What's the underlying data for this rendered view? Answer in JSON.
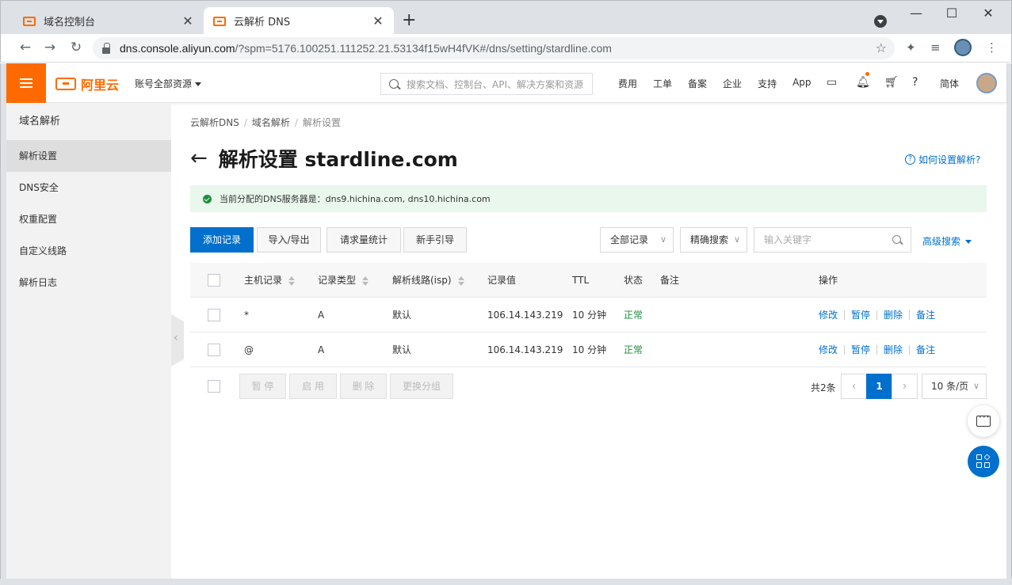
{
  "browser": {
    "tabs": [
      {
        "label": "域名控制台",
        "close": "✕"
      },
      {
        "label": "云解析 DNS",
        "close": "✕"
      }
    ],
    "new_tab": "+",
    "window_controls": {
      "minimize": "—",
      "maximize": "☐",
      "close": "✕"
    },
    "url_host": "dns.console.aliyun.com",
    "url_path": "/?spm=5176.100251.111252.21.53134f15wH4fVK#/dns/setting/stardline.com"
  },
  "topnav": {
    "brand": "阿里云",
    "account": "账号全部资源",
    "search_placeholder": "搜索文档、控制台、API、解决方案和资源",
    "links": [
      "费用",
      "工单",
      "备案",
      "企业",
      "支持",
      "App"
    ],
    "lang": "简体"
  },
  "sidebar": {
    "title": "域名解析",
    "items": [
      "解析设置",
      "DNS安全",
      "权重配置",
      "自定义线路",
      "解析日志"
    ]
  },
  "breadcrumb": [
    "云解析DNS",
    "域名解析",
    "解析设置"
  ],
  "page": {
    "title": "解析设置 stardline.com",
    "help": "如何设置解析?",
    "alert": "当前分配的DNS服务器是：dns9.hichina.com, dns10.hichina.com"
  },
  "toolbar": {
    "add": "添加记录",
    "import_export": "导入/导出",
    "stats": "请求量统计",
    "guide": "新手引导",
    "filter": "全部记录",
    "search_mode": "精确搜索",
    "keyword_placeholder": "输入关键字",
    "advanced": "高级搜索"
  },
  "table": {
    "headers": [
      "主机记录",
      "记录类型",
      "解析线路(isp)",
      "记录值",
      "TTL",
      "状态",
      "备注",
      "操作"
    ],
    "rows": [
      {
        "host": "*",
        "type": "A",
        "line": "默认",
        "value": "106.14.143.219",
        "ttl": "10 分钟",
        "status": "正常",
        "remark": ""
      },
      {
        "host": "@",
        "type": "A",
        "line": "默认",
        "value": "106.14.143.219",
        "ttl": "10 分钟",
        "status": "正常",
        "remark": ""
      }
    ],
    "row_actions": [
      "修改",
      "暂停",
      "删除",
      "备注"
    ]
  },
  "batch": {
    "pause": "暂 停",
    "enable": "启 用",
    "delete": "删 除",
    "regroup": "更换分组"
  },
  "pagination": {
    "total": "共2条",
    "prev": "‹",
    "current": "1",
    "next": "›",
    "page_size": "10 条/页"
  },
  "colors": {
    "brand_orange": "#ff6a00",
    "primary_blue": "#0070cc",
    "success_green": "#1e8e3e"
  }
}
